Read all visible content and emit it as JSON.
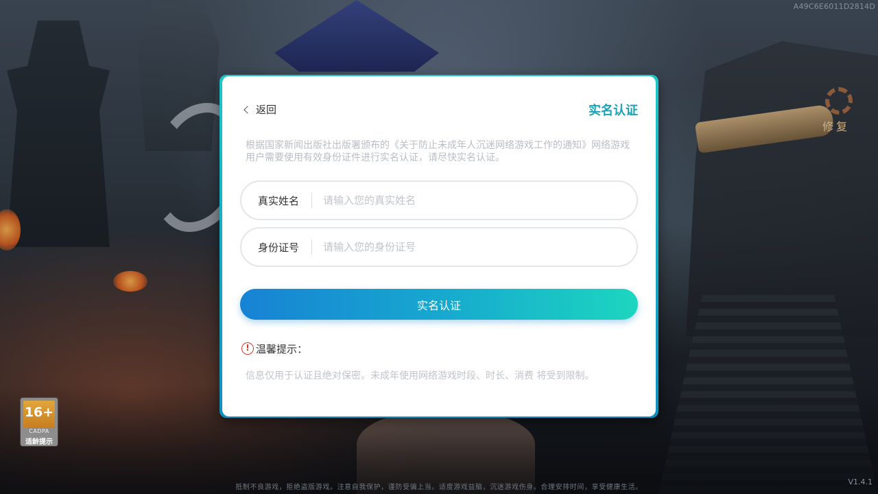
{
  "background": {
    "device_id": "A49C6E6011D2814D",
    "repair_label": "修复",
    "footer_notice": "抵制不良游戏，拒绝盗版游戏。注意自我保护，谨防受骗上当。适度游戏益脑，沉迷游戏伤身。合理安排时间，享受健康生活。",
    "version": "V1.4.1"
  },
  "age_rating": {
    "number": "16+",
    "org": "CADPA",
    "label": "适龄提示"
  },
  "dialog": {
    "back_label": "返回",
    "title": "实名认证",
    "notice": "根据国家新闻出版社出版署颁布的《关于防止未成年人沉迷网络游戏工作的通知》网络游戏用户需要使用有效身份证件进行实名认证，请尽快实名认证。",
    "name_field": {
      "label": "真实姓名",
      "value": "",
      "placeholder": "请输入您的真实姓名"
    },
    "id_field": {
      "label": "身份证号",
      "value": "",
      "placeholder": "请输入您的身份证号"
    },
    "submit_label": "实名认证",
    "tip_title": "温馨提示：",
    "tip_icon_glyph": "!",
    "tip_text": "信息仅用于认证且绝对保密。未成年使用网络游戏时段、时长、消费 将受到限制。"
  },
  "colors": {
    "accent": "#19a3b6",
    "button_gradient_start": "#1782d4",
    "button_gradient_end": "#1cd6bf",
    "warning": "#d33a2c"
  }
}
